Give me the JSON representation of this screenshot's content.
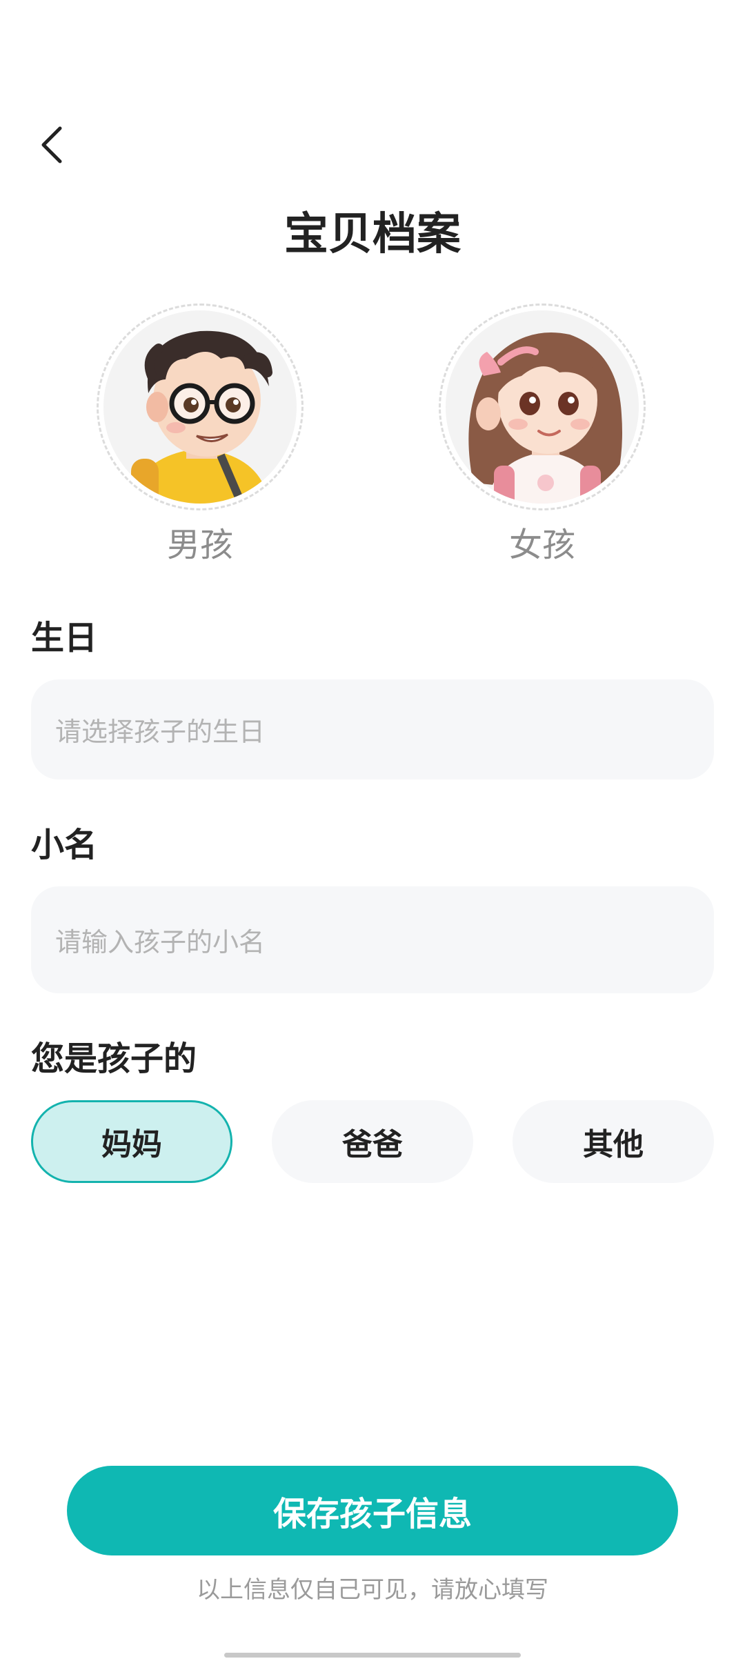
{
  "header": {
    "back_icon": "chevron-left-icon",
    "title": "宝贝档案"
  },
  "gender": {
    "options": [
      {
        "label": "男孩",
        "avatar": "boy-avatar"
      },
      {
        "label": "女孩",
        "avatar": "girl-avatar"
      }
    ]
  },
  "birthday": {
    "label": "生日",
    "placeholder": "请选择孩子的生日",
    "value": ""
  },
  "nickname": {
    "label": "小名",
    "placeholder": "请输入孩子的小名",
    "value": ""
  },
  "relation": {
    "label": "您是孩子的",
    "options": [
      "妈妈",
      "爸爸",
      "其他"
    ],
    "selected": "妈妈"
  },
  "actions": {
    "save_label": "保存孩子信息",
    "privacy_note": "以上信息仅自己可见，请放心填写"
  },
  "colors": {
    "accent": "#0fb8b3",
    "selected_bg": "#cdf0ef",
    "input_bg": "#f6f7f9"
  }
}
